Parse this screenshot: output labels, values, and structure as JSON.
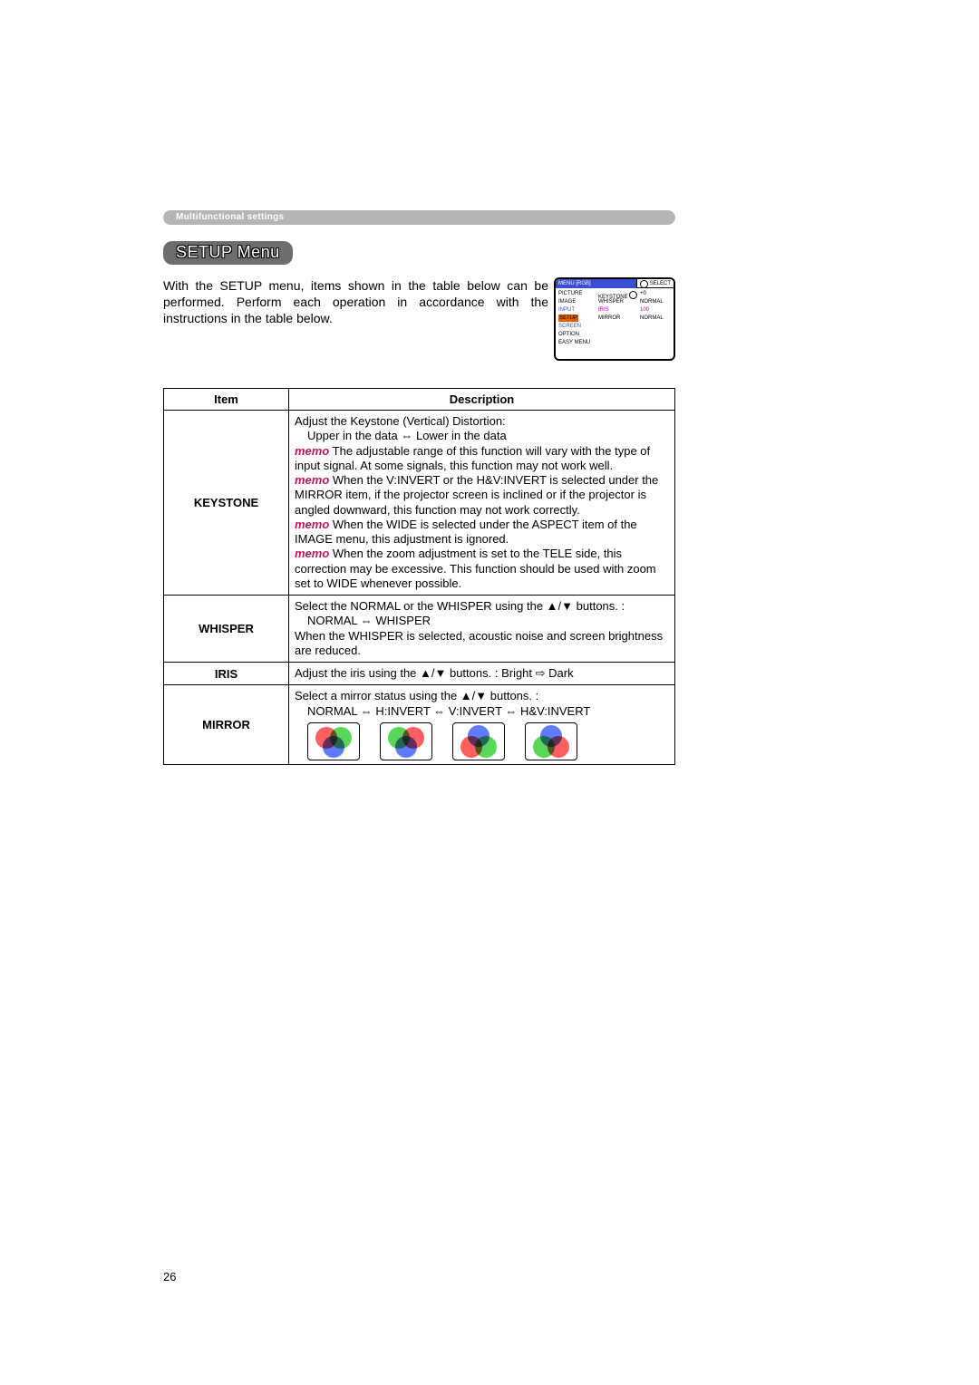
{
  "section_label": "Multifunctional settings",
  "title": "SETUP Menu",
  "intro": "With the SETUP menu, items shown in the table below can be performed. Perform each operation in accordance with the instructions in the table below.",
  "osd": {
    "header_left": "MENU [RGB]",
    "header_right": "SELECT",
    "left": [
      "PICTURE",
      "IMAGE",
      "INPUT",
      "SETUP",
      "SCREEN",
      "OPTION",
      "EASY MENU"
    ],
    "mid": [
      "KEYSTONE",
      "WHISPER",
      "IRIS",
      "MIRROR"
    ],
    "right": [
      "+0",
      "NORMAL",
      "100",
      "NORMAL"
    ]
  },
  "table": {
    "head_item": "Item",
    "head_desc": "Description",
    "rows": [
      {
        "item": "KEYSTONE",
        "desc": {
          "line1": "Adjust the Keystone (Vertical) Distortion:",
          "line2": "Upper in the data ⇔ Lower in the data",
          "m1": "memo",
          "m1txt": " The adjustable range of this function will vary with the type of input signal. At some signals, this function may not work well.",
          "m2": "memo",
          "m2txt": " When the V:INVERT or the H&V:INVERT is selected under the MIRROR item, if the projector screen is inclined or if the projector is angled downward, this function may not work correctly.",
          "m3": "memo",
          "m3txt": " When the WIDE is selected under the ASPECT item of the IMAGE menu, this adjustment is ignored.",
          "m4": "memo",
          "m4txt": " When the zoom adjustment is set to the TELE side, this correction may be excessive. This function should be used with zoom set to WIDE whenever possible."
        }
      },
      {
        "item": "WHISPER",
        "desc": {
          "line1": "Select the NORMAL or the WHISPER using the ▲/▼ buttons. :",
          "line2": "NORMAL ⇔ WHISPER",
          "line3": "When the WHISPER is selected, acoustic noise and screen brightness are reduced."
        }
      },
      {
        "item": "IRIS",
        "desc": {
          "line1": "Adjust the iris using the ▲/▼ buttons. :    Bright ⇨ Dark"
        }
      },
      {
        "item": "MIRROR",
        "desc": {
          "line1": "Select a mirror status using the ▲/▼ buttons. :",
          "line2": "NORMAL ⇔ H:INVERT ⇔ V:INVERT ⇔ H&V:INVERT"
        }
      }
    ]
  },
  "mirror_variants": [
    {
      "r": "tl",
      "g": "tr",
      "b": "b"
    },
    {
      "r": "tr",
      "g": "tl",
      "b": "b"
    },
    {
      "r": "bl",
      "g": "br",
      "b": "t"
    },
    {
      "r": "br",
      "g": "bl",
      "b": "t"
    }
  ],
  "page_number": "26"
}
